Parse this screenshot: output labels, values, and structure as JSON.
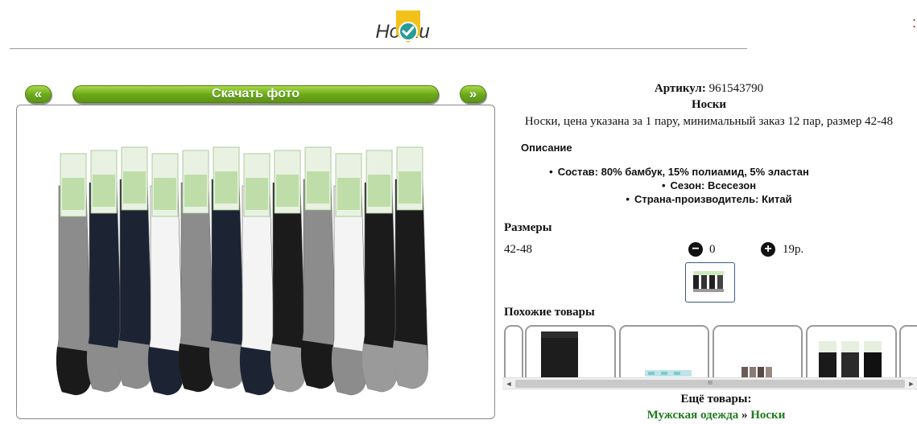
{
  "header": {
    "title": "Носки",
    "corner_mark": ":"
  },
  "photo_nav": {
    "prev": "«",
    "download": "Скачать фото",
    "next": "»"
  },
  "product": {
    "sku_label": "Артикул:",
    "sku_value": "961543790",
    "name": "Носки",
    "summary": "Носки, цена указана за 1 пару, минимальный заказ 12 пар, размер 42-48"
  },
  "description": {
    "heading": "Описание",
    "items": [
      "Состав: 80% бамбук, 15% полиамид, 5% эластан",
      "Сезон: Всесезон",
      "Страна-производитель: Китай"
    ]
  },
  "sizes": {
    "heading": "Размеры",
    "size": "42-48",
    "minus": "−",
    "quantity": "0",
    "plus": "+",
    "price": "19р."
  },
  "similar": {
    "heading": "Похожие товары"
  },
  "scroll_thumb_grip": "III",
  "more": {
    "heading": "Ещё товары:",
    "crumb_1": "Мужская одежда",
    "separator": "»",
    "crumb_2": "Носки"
  },
  "colors": {
    "accent_green": "#6aa818",
    "link_green": "#1e7a1e",
    "badge_yellow": "#f2c21b",
    "badge_teal": "#2a9a9a"
  }
}
